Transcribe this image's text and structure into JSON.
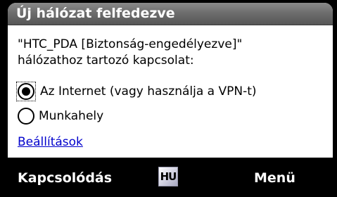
{
  "dialog": {
    "title": "Új hálózat felfedezve",
    "message_line1": "\"HTC_PDA [Biztonság-engedélyezve]\"",
    "message_line2": "hálózathoz tartozó kapcsolat:",
    "options": [
      {
        "label": "Az Internet (vagy használja a VPN-t)",
        "selected": true
      },
      {
        "label": "Munkahely",
        "selected": false
      }
    ],
    "settings_link": "Beállítások"
  },
  "softkeys": {
    "left_label": "Kapcsolódás",
    "right_label": "Menü",
    "input_indicator": "HU"
  },
  "colors": {
    "titlebar": "#6e6e6e",
    "link": "#0000cc",
    "background": "#000000"
  }
}
